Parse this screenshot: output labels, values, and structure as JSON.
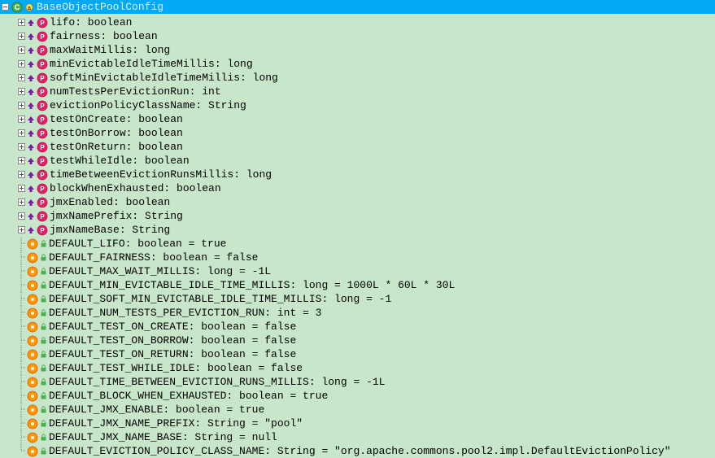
{
  "header": {
    "title": "BaseObjectPoolConfig"
  },
  "properties": [
    {
      "label": "lifo: boolean"
    },
    {
      "label": "fairness: boolean"
    },
    {
      "label": "maxWaitMillis: long"
    },
    {
      "label": "minEvictableIdleTimeMillis: long"
    },
    {
      "label": "softMinEvictableIdleTimeMillis: long"
    },
    {
      "label": "numTestsPerEvictionRun: int"
    },
    {
      "label": "evictionPolicyClassName: String"
    },
    {
      "label": "testOnCreate: boolean"
    },
    {
      "label": "testOnBorrow: boolean"
    },
    {
      "label": "testOnReturn: boolean"
    },
    {
      "label": "testWhileIdle: boolean"
    },
    {
      "label": "timeBetweenEvictionRunsMillis: long"
    },
    {
      "label": "blockWhenExhausted: boolean"
    },
    {
      "label": "jmxEnabled: boolean"
    },
    {
      "label": "jmxNamePrefix: String"
    },
    {
      "label": "jmxNameBase: String"
    }
  ],
  "constants": [
    {
      "label": "DEFAULT_LIFO: boolean = true"
    },
    {
      "label": "DEFAULT_FAIRNESS: boolean = false"
    },
    {
      "label": "DEFAULT_MAX_WAIT_MILLIS: long = -1L"
    },
    {
      "label": "DEFAULT_MIN_EVICTABLE_IDLE_TIME_MILLIS: long = 1000L * 60L * 30L"
    },
    {
      "label": "DEFAULT_SOFT_MIN_EVICTABLE_IDLE_TIME_MILLIS: long = -1"
    },
    {
      "label": "DEFAULT_NUM_TESTS_PER_EVICTION_RUN: int = 3"
    },
    {
      "label": "DEFAULT_TEST_ON_CREATE: boolean = false"
    },
    {
      "label": "DEFAULT_TEST_ON_BORROW: boolean = false"
    },
    {
      "label": "DEFAULT_TEST_ON_RETURN: boolean = false"
    },
    {
      "label": "DEFAULT_TEST_WHILE_IDLE: boolean = false"
    },
    {
      "label": "DEFAULT_TIME_BETWEEN_EVICTION_RUNS_MILLIS: long = -1L"
    },
    {
      "label": "DEFAULT_BLOCK_WHEN_EXHAUSTED: boolean = true"
    },
    {
      "label": "DEFAULT_JMX_ENABLE: boolean = true"
    },
    {
      "label": "DEFAULT_JMX_NAME_PREFIX: String = \"pool\""
    },
    {
      "label": "DEFAULT_JMX_NAME_BASE: String = null"
    },
    {
      "label": "DEFAULT_EVICTION_POLICY_CLASS_NAME: String = \"org.apache.commons.pool2.impl.DefaultEvictionPolicy\""
    }
  ]
}
